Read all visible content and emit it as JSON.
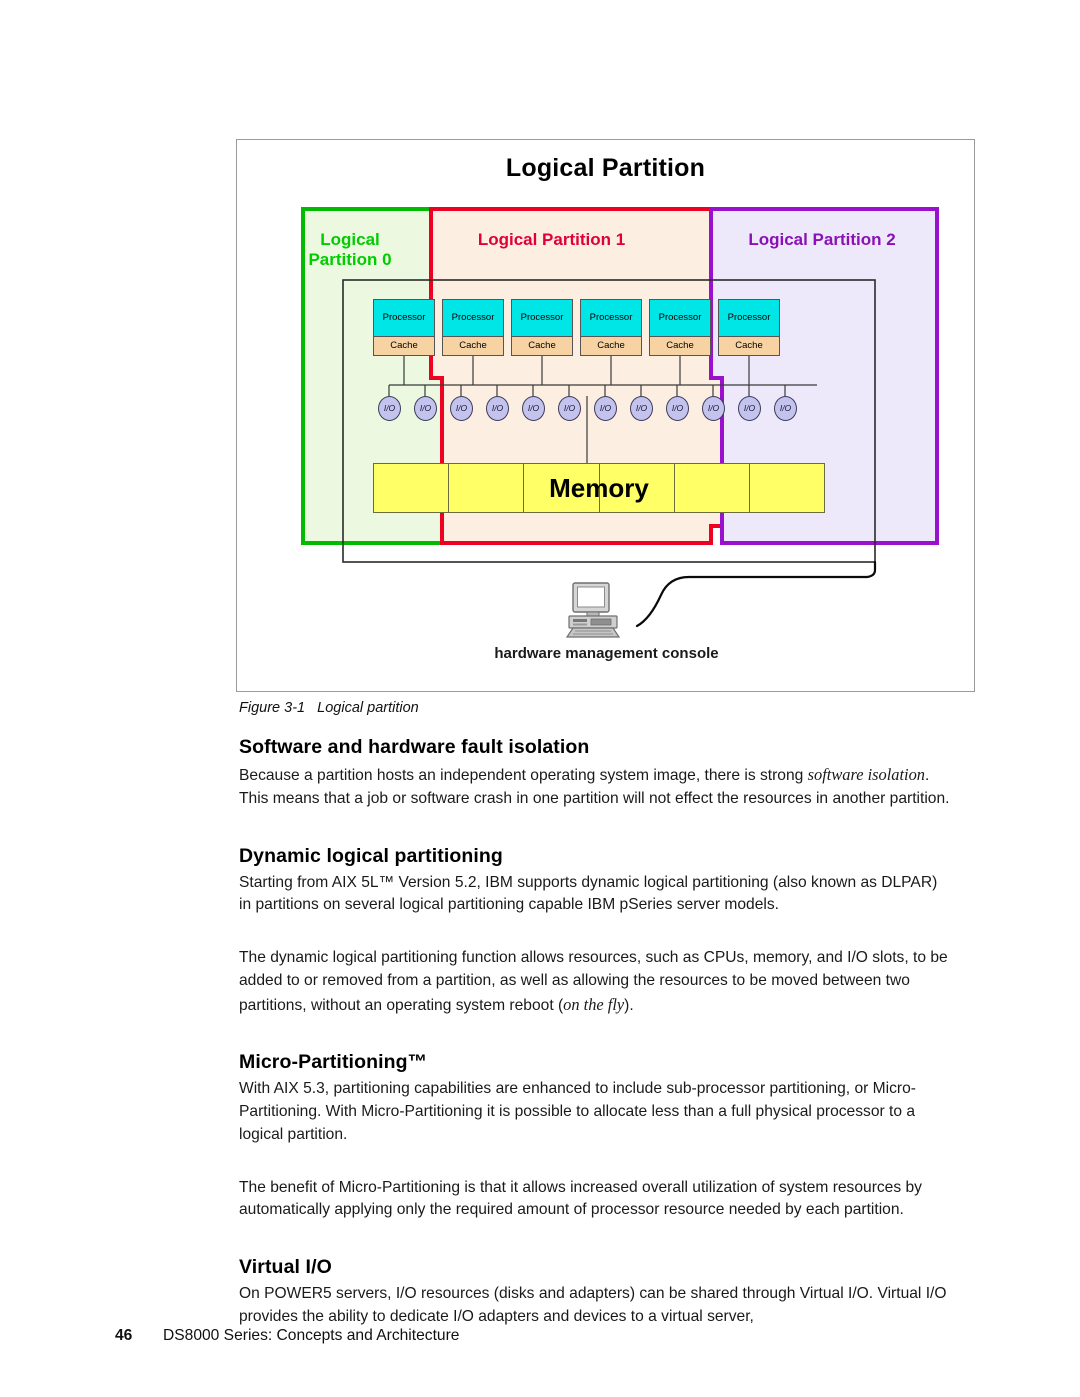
{
  "figure": {
    "diagram_title": "Logical Partition",
    "partitions": [
      {
        "id": "lp0",
        "label": "Logical\nPartition 0",
        "text_color": "#00cc00",
        "border_color": "#00bb00",
        "fill_color": "#ecf9e0"
      },
      {
        "id": "lp1",
        "label": "Logical Partition 1",
        "text_color": "#e00038",
        "border_color": "#ee0022",
        "fill_color": "#fdeee2"
      },
      {
        "id": "lp2",
        "label": "Logical Partition 2",
        "text_color": "#8a11b5",
        "border_color": "#9911cc",
        "fill_color": "#eee8fb"
      }
    ],
    "processors": [
      {
        "processor_label": "Processor",
        "cache_label": "Cache"
      },
      {
        "processor_label": "Processor",
        "cache_label": "Cache"
      },
      {
        "processor_label": "Processor",
        "cache_label": "Cache"
      },
      {
        "processor_label": "Processor",
        "cache_label": "Cache"
      },
      {
        "processor_label": "Processor",
        "cache_label": "Cache"
      },
      {
        "processor_label": "Processor",
        "cache_label": "Cache"
      }
    ],
    "io_ports": [
      {
        "label": "I/O"
      },
      {
        "label": "I/O"
      },
      {
        "label": "I/O"
      },
      {
        "label": "I/O"
      },
      {
        "label": "I/O"
      },
      {
        "label": "I/O"
      },
      {
        "label": "I/O"
      },
      {
        "label": "I/O"
      },
      {
        "label": "I/O"
      },
      {
        "label": "I/O"
      },
      {
        "label": "I/O"
      },
      {
        "label": "I/O"
      }
    ],
    "memory": {
      "label": "Memory",
      "cell_count": 6,
      "fill_color": "#ffff66"
    },
    "console": {
      "caption": "hardware management console"
    },
    "colors": {
      "processor_fill": "#00e5e5",
      "cache_fill": "#f7d3a4",
      "io_fill": "#c3c3ee"
    },
    "caption": "Figure 3-1   Logical partition"
  },
  "content": {
    "sections": [
      {
        "heading": "Software and hardware fault isolation",
        "paragraphs": [
          {
            "parts": [
              {
                "text": "Because a partition hosts an independent operating system image, there is strong ",
                "style": "normal"
              },
              {
                "text": "software isolation",
                "style": "italic"
              },
              {
                "text": ". This means that a job or software crash in one partition will not effect the resources in another partition.",
                "style": "normal"
              }
            ]
          }
        ]
      },
      {
        "heading": "Dynamic logical partitioning",
        "paragraphs": [
          {
            "parts": [
              {
                "text": "Starting from AIX 5L™ Version 5.2, IBM supports dynamic logical partitioning (also known as DLPAR) in partitions on several logical partitioning capable IBM pSeries server models.",
                "style": "normal"
              }
            ]
          },
          {
            "parts": [
              {
                "text": "The dynamic logical partitioning function allows resources, such as CPUs, memory, and I/O slots, to be added to or removed from a partition, as well as allowing the resources to be moved between two partitions, without an operating system reboot (",
                "style": "normal"
              },
              {
                "text": "on the fly",
                "style": "italic"
              },
              {
                "text": ").",
                "style": "normal"
              }
            ]
          }
        ]
      },
      {
        "heading": "Micro-Partitioning™",
        "paragraphs": [
          {
            "parts": [
              {
                "text": "With AIX 5.3, partitioning capabilities are enhanced to include sub-processor partitioning, or Micro-Partitioning. With Micro-Partitioning it is possible to allocate less than a full physical processor to a logical partition.",
                "style": "normal"
              }
            ]
          },
          {
            "parts": [
              {
                "text": "The benefit of Micro-Partitioning is that it allows increased overall utilization of system resources by automatically applying only the required amount of processor resource needed by each partition.",
                "style": "normal"
              }
            ]
          }
        ]
      },
      {
        "heading": "Virtual I/O",
        "paragraphs": [
          {
            "parts": [
              {
                "text": "On POWER5 servers, I/O resources (disks and adapters) can be shared through Virtual I/O. Virtual I/O provides the ability to dedicate I/O adapters and devices to a virtual server,",
                "style": "normal"
              }
            ]
          }
        ]
      }
    ]
  },
  "footer": {
    "page_number": "46",
    "book_title": "DS8000 Series: Concepts and Architecture"
  }
}
